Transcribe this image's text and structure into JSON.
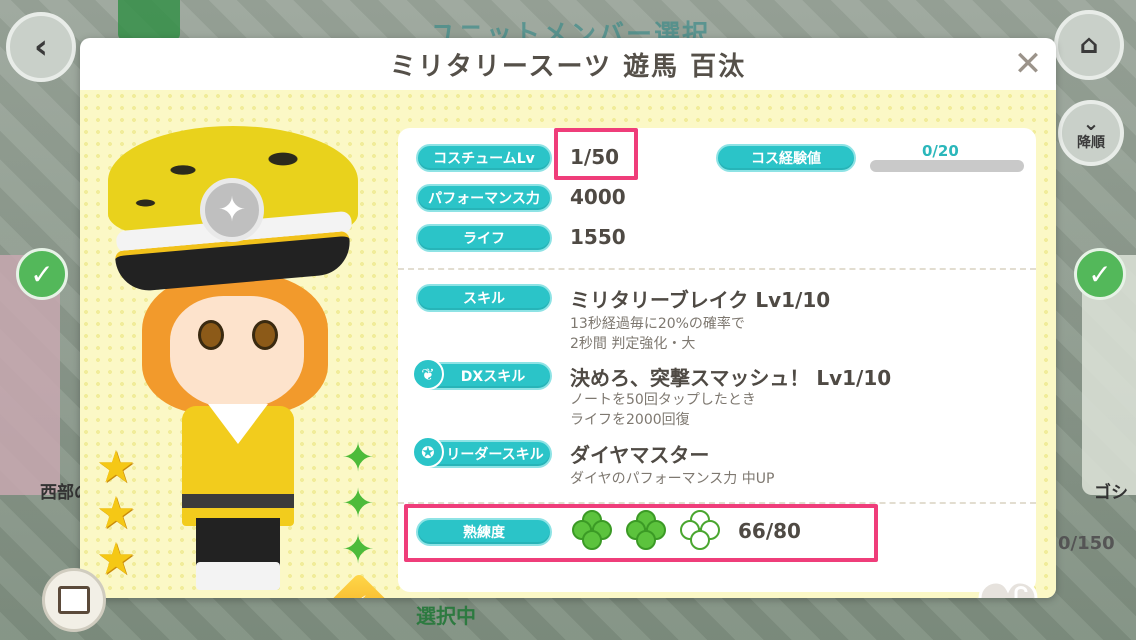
{
  "background": {
    "header_title": "ユニットメンバー選択",
    "sort_label": "降順",
    "left_card_label": "西部の",
    "right_card_label": "ゴシ",
    "bottom_label": "選択中",
    "count_text": "0/150"
  },
  "modal": {
    "title": "ミリタリースーツ 遊馬 百汰",
    "close_glyph": "✕",
    "stats": {
      "costume_lv_label": "コスチュームLv",
      "costume_lv_value": "1/50",
      "cos_exp_label": "コス経験値",
      "cos_exp_value": "0/20",
      "cos_exp_fraction": 0,
      "performance_label": "パフォーマンス力",
      "performance_value": "4000",
      "life_label": "ライフ",
      "life_value": "1550"
    },
    "skills": {
      "skill_label": "スキル",
      "skill_name": "ミリタリーブレイク Lv1/10",
      "skill_desc": "13秒経過毎に20%の確率で\n2秒間 判定強化・大",
      "dx_label": "DXスキル",
      "dx_name": "決めろ、突撃スマッシュ！ Lv1/10",
      "dx_desc": "ノートを50回タップしたとき\nライフを2000回復",
      "leader_label": "リーダースキル",
      "leader_name": "ダイヤマスター",
      "leader_desc": "ダイヤのパフォーマンス力 中UP"
    },
    "proficiency": {
      "label": "熟練度",
      "value": "66/80",
      "clovers_filled": 2,
      "clovers_total": 3
    },
    "rarity_stars": 3,
    "colors": {
      "pill": "#2bc4c8",
      "highlight": "#ef3d7a",
      "panel_bg": "#fbf8c6"
    }
  }
}
